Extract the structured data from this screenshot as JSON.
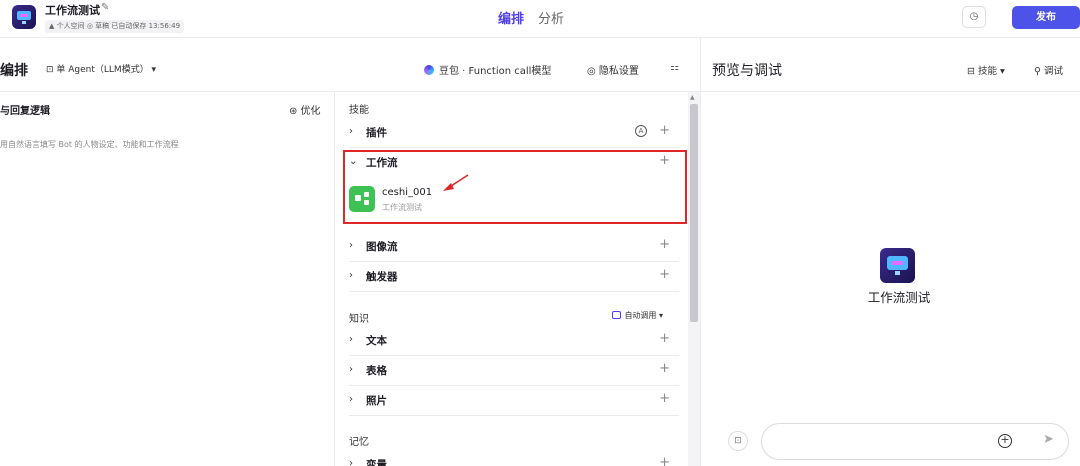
{
  "header": {
    "bot_title": "工作流测试",
    "meta": "▲ 个人空间  ◎ 草稿  已自动保存 13:56:49",
    "tabs": [
      "编排",
      "分析"
    ],
    "publish": "发布",
    "history_icon": "clock-icon"
  },
  "toolbar": {
    "section_title": "编排",
    "agent_mode": "⊡ 单 Agent（LLM模式） ▾",
    "model": "豆包 · Function call模型",
    "privacy": "◎ 隐私设置",
    "grid_icon": "⚏"
  },
  "left": {
    "title": "与回复逻辑",
    "optimize": "⊛ 优化",
    "placeholder": "用自然语言填写 Bot 的人物设定、功能和工作流程"
  },
  "middle": {
    "skills_label": "技能",
    "plugins": "插件",
    "workflow": "工作流",
    "workflow_item": {
      "name": "ceshi_001",
      "desc": "工作流测试"
    },
    "image_flow": "图像流",
    "trigger": "触发器",
    "knowledge_label": "知识",
    "auto_call": "自动调用 ▾",
    "text": "文本",
    "table": "表格",
    "photo": "照片",
    "memory_label": "记忆",
    "variable": "变量"
  },
  "right": {
    "title": "预览与调试",
    "skill": "⊟ 技能 ▾",
    "debug": "⚲ 调试",
    "bot_name": "工作流测试",
    "clear_icon": "⊡"
  },
  "colors": {
    "accent": "#4d53e8",
    "highlight": "#e02727",
    "workflow_green": "#3ec254"
  }
}
